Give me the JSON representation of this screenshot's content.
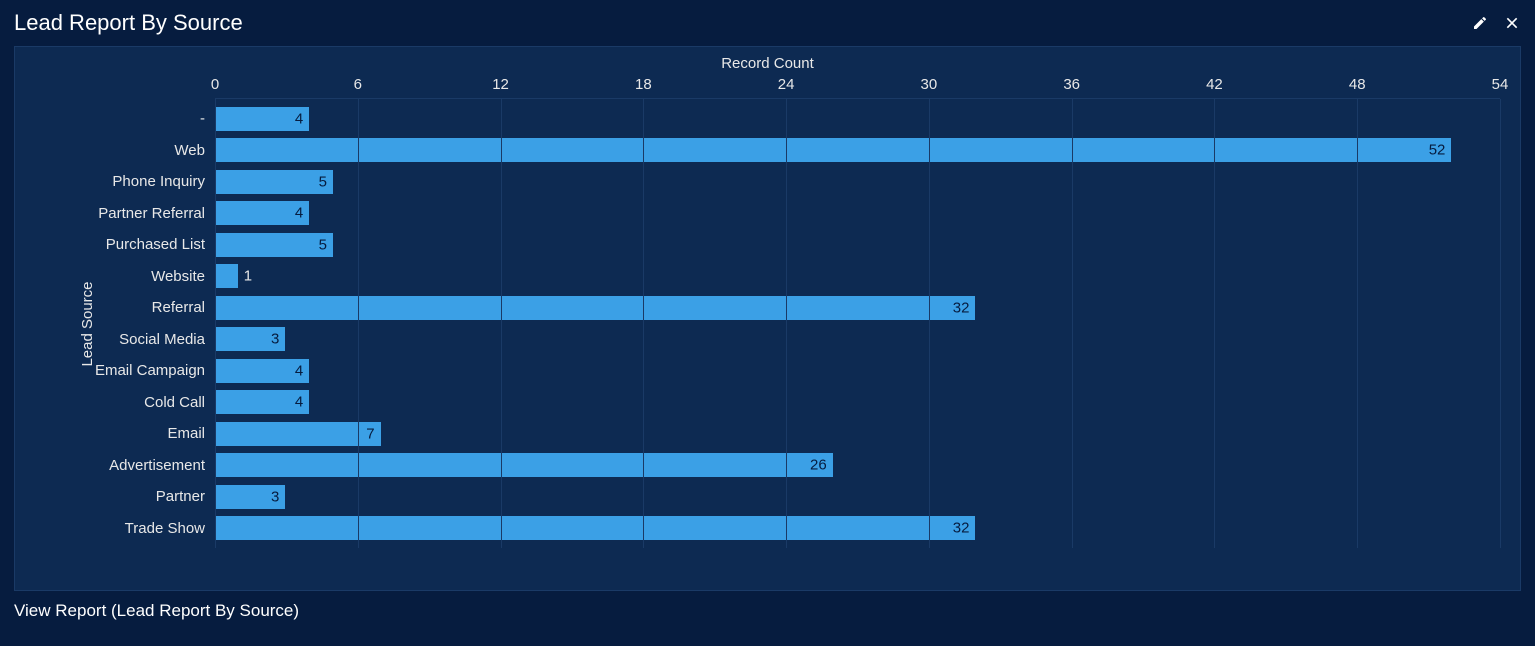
{
  "header": {
    "title": "Lead Report By Source"
  },
  "footer": {
    "link_text": "View Report (Lead Report By Source)"
  },
  "chart_data": {
    "type": "bar",
    "orientation": "horizontal",
    "title": "",
    "xlabel": "Record Count",
    "ylabel": "Lead Source",
    "xlim": [
      0,
      54
    ],
    "x_ticks": [
      0,
      6,
      12,
      18,
      24,
      30,
      36,
      42,
      48,
      54
    ],
    "categories": [
      "-",
      "Web",
      "Phone Inquiry",
      "Partner Referral",
      "Purchased List",
      "Website",
      "Referral",
      "Social Media",
      "Email Campaign",
      "Cold Call",
      "Email",
      "Advertisement",
      "Partner",
      "Trade Show"
    ],
    "values": [
      4,
      52,
      5,
      4,
      5,
      1,
      32,
      3,
      4,
      4,
      7,
      26,
      3,
      32
    ],
    "bar_color": "#3ba0e6"
  }
}
